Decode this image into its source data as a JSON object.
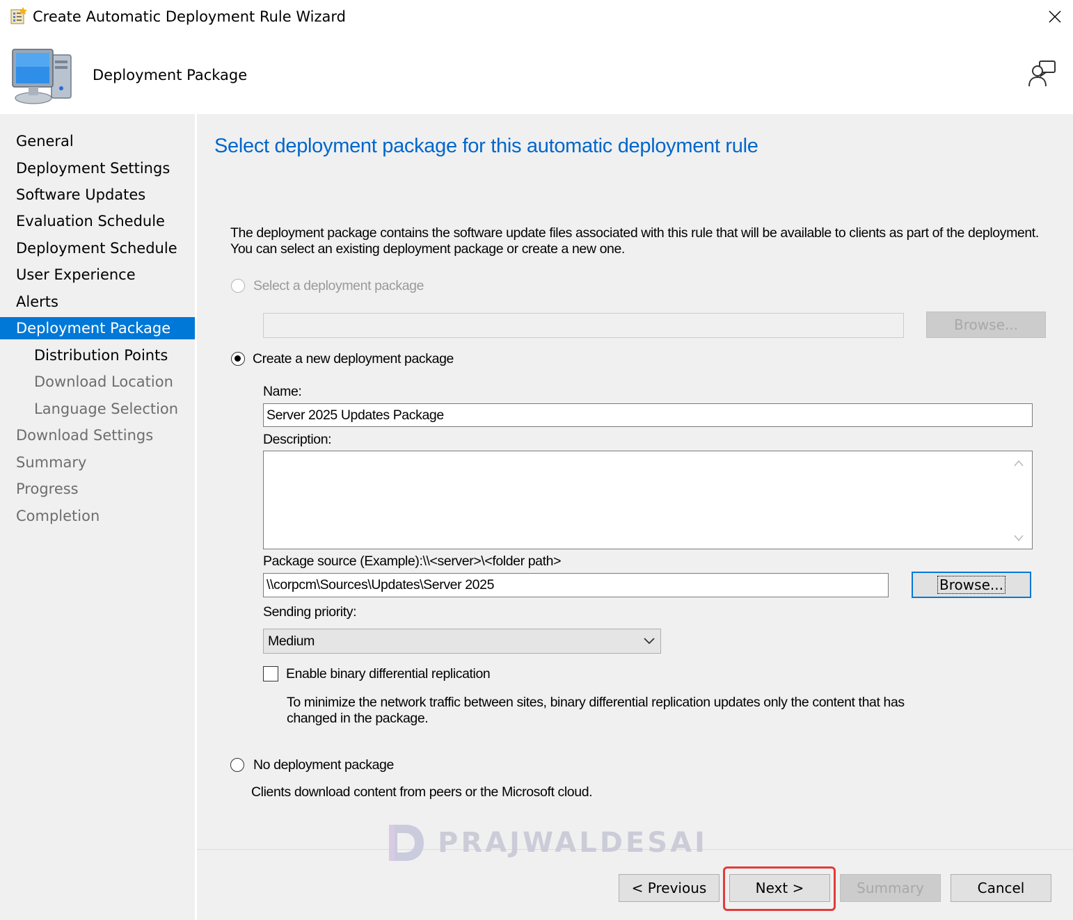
{
  "window": {
    "title": "Create Automatic Deployment Rule Wizard"
  },
  "header": {
    "title": "Deployment Package"
  },
  "sidebar": {
    "items": [
      {
        "label": "General"
      },
      {
        "label": "Deployment Settings"
      },
      {
        "label": "Software Updates"
      },
      {
        "label": "Evaluation Schedule"
      },
      {
        "label": "Deployment Schedule"
      },
      {
        "label": "User Experience"
      },
      {
        "label": "Alerts"
      },
      {
        "label": "Deployment Package"
      },
      {
        "label": "Distribution Points"
      },
      {
        "label": "Download Location"
      },
      {
        "label": "Language Selection"
      },
      {
        "label": "Download Settings"
      },
      {
        "label": "Summary"
      },
      {
        "label": "Progress"
      },
      {
        "label": "Completion"
      }
    ]
  },
  "main": {
    "heading": "Select deployment package for this automatic deployment rule",
    "description_line1": "The deployment package contains the software update files associated with this rule that will be available to clients as part of the deployment.",
    "description_line2": "You can select an existing deployment package or create a new one.",
    "option_select_existing": "Select a deployment package",
    "browse_disabled_label": "Browse...",
    "option_create_new": "Create a new deployment package",
    "name_label": "Name:",
    "name_value": "Server 2025 Updates Package",
    "description_label": "Description:",
    "description_value": "",
    "package_source_label": "Package source (Example):\\\\<server>\\<folder path>",
    "package_source_value": "\\\\corpcm\\Sources\\Updates\\Server 2025",
    "browse_label": "Browse...",
    "sending_priority_label": "Sending priority:",
    "sending_priority_value": "Medium",
    "binary_replication_label": "Enable binary differential replication",
    "binary_replication_checked": false,
    "binary_replication_help_line1": "To minimize the network traffic between sites, binary differential replication updates only the content that has",
    "binary_replication_help_line2": "changed in the package.",
    "option_no_package": "No deployment package",
    "no_package_help": "Clients download content from peers or the Microsoft cloud."
  },
  "footer": {
    "previous_label": "< Previous",
    "next_label": "Next >",
    "summary_label": "Summary",
    "cancel_label": "Cancel"
  },
  "watermark": {
    "text": "PRAJWALDESAI"
  },
  "colors": {
    "accent": "#0078d7",
    "heading": "#0066cc",
    "highlight": "#e03c3c"
  }
}
